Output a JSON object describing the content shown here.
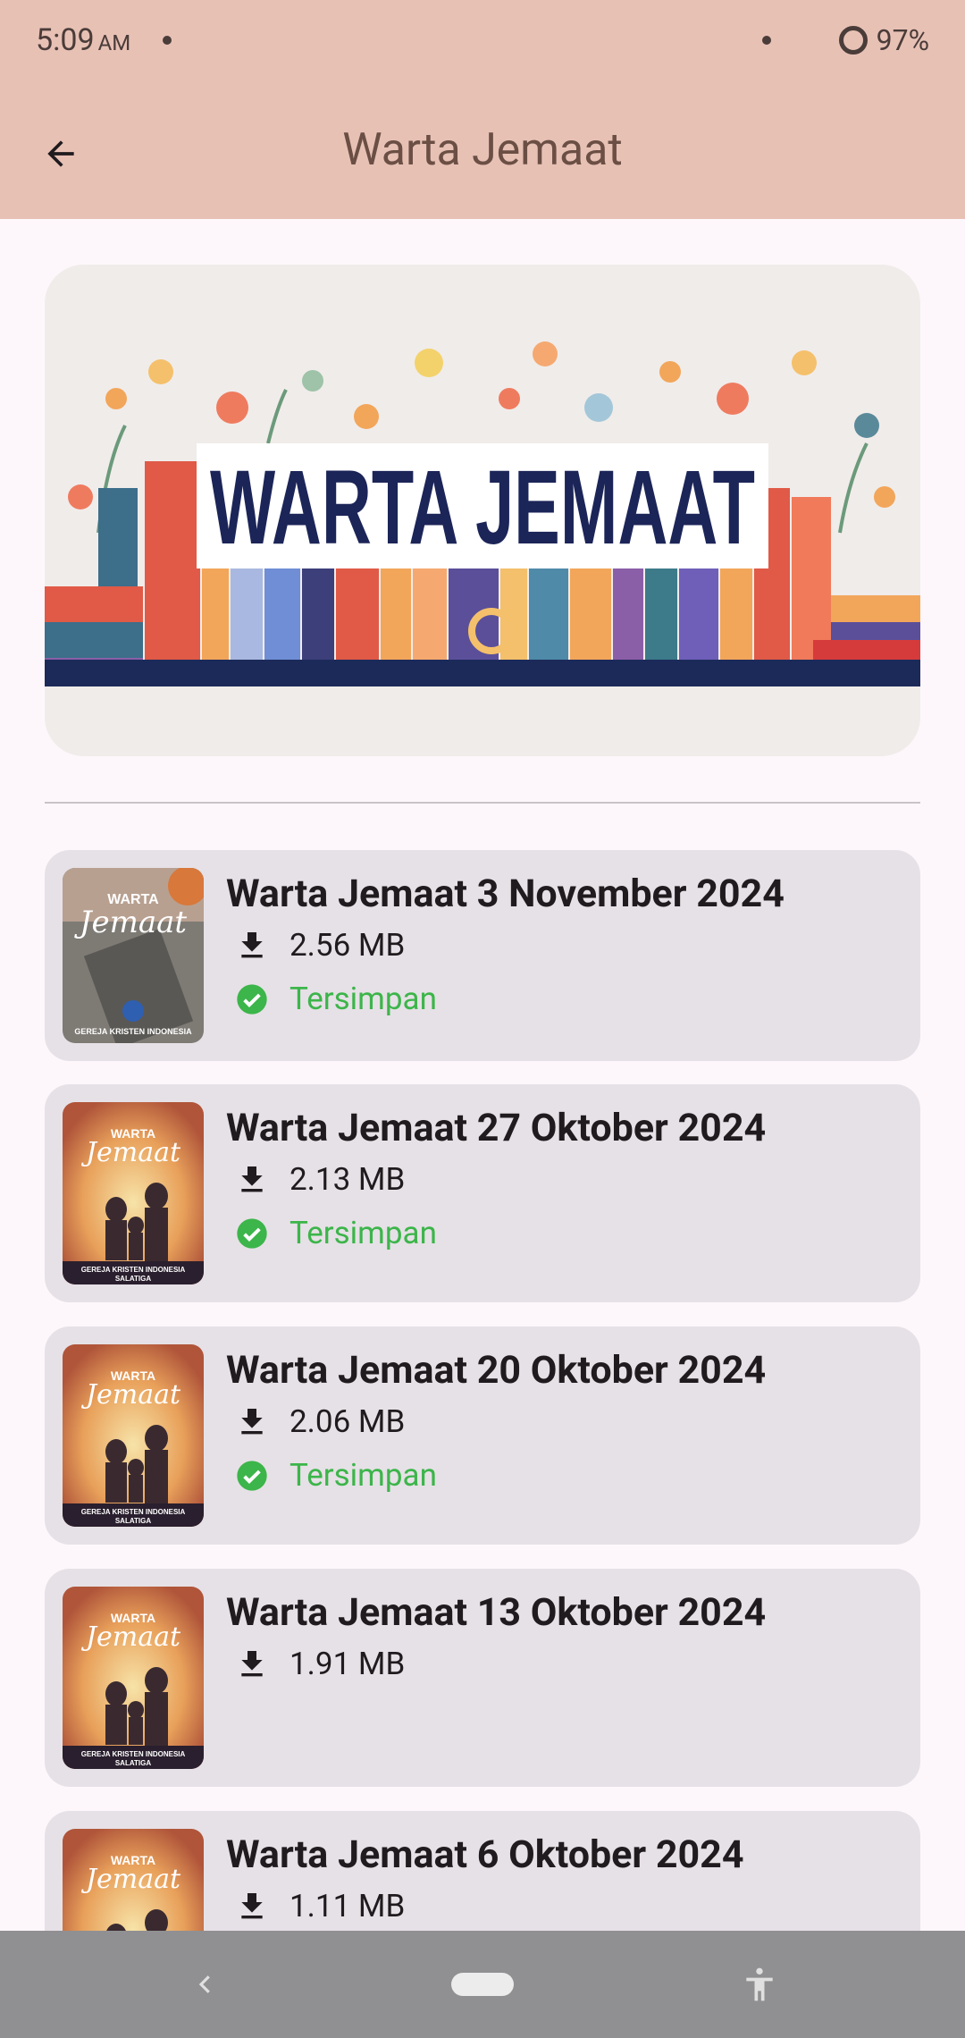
{
  "status_bar": {
    "time": "5:09",
    "ampm": "AM",
    "battery": "97%"
  },
  "app_bar": {
    "title": "Warta Jemaat"
  },
  "banner": {
    "text": "WARTA JEMAAT"
  },
  "items": [
    {
      "title": "Warta Jemaat 3 November 2024",
      "size": "2.56 MB",
      "status": "Tersimpan"
    },
    {
      "title": "Warta Jemaat 27 Oktober 2024",
      "size": "2.13 MB",
      "status": "Tersimpan"
    },
    {
      "title": "Warta Jemaat 20 Oktober 2024",
      "size": "2.06 MB",
      "status": "Tersimpan"
    },
    {
      "title": "Warta Jemaat 13 Oktober 2024",
      "size": "1.91 MB"
    },
    {
      "title": "Warta Jemaat 6 Oktober 2024",
      "size": "1.11 MB"
    }
  ],
  "cover": {
    "word1": "WARTA",
    "word2": "Jemaat",
    "church": "GEREJA KRISTEN INDONESIA",
    "city": "SALATIGA"
  },
  "colors": {
    "appbar": "#e8c1b5",
    "saved": "#3cb54a",
    "card": "#e6e1e6"
  },
  "icons": {
    "back": "arrow-left-icon",
    "download": "download-icon",
    "saved": "check-circle-icon",
    "accessibility": "accessibility-icon"
  }
}
